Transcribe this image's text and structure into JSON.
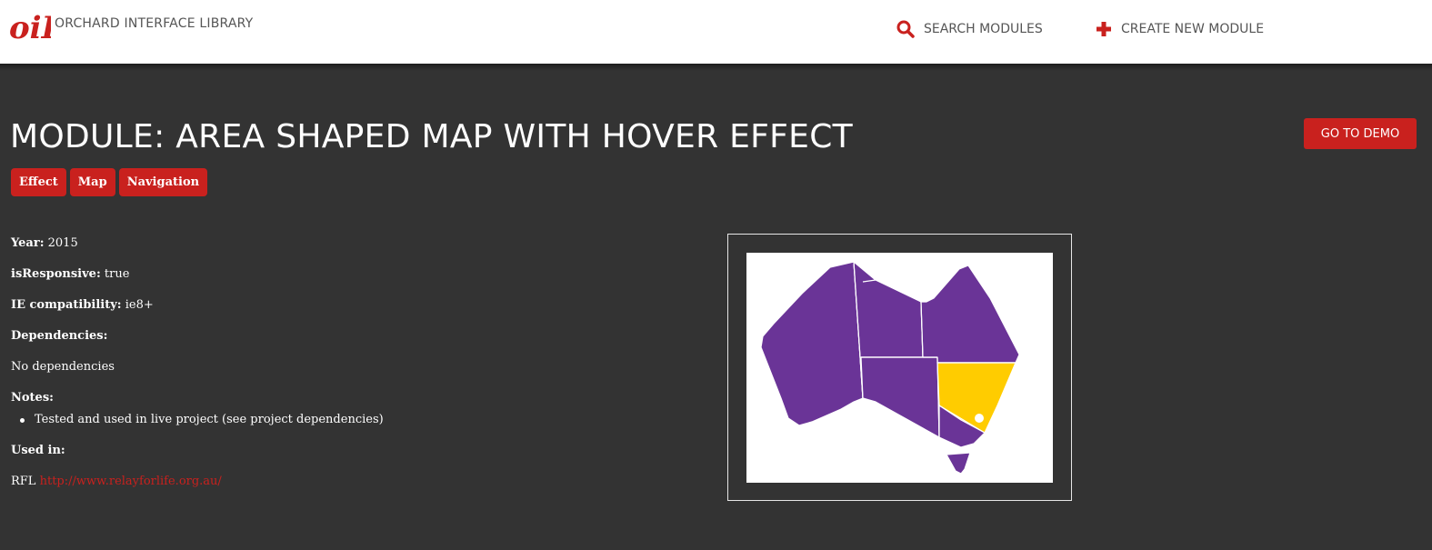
{
  "brand": {
    "logo_text": "oiL",
    "name": "ORCHARD INTERFACE LIBRARY"
  },
  "nav": {
    "search_label": "SEARCH MODULES",
    "create_label": "CREATE NEW MODULE"
  },
  "module": {
    "title": "MODULE: AREA SHAPED MAP WITH HOVER EFFECT",
    "demo_label": "GO TO DEMO",
    "tags": [
      "Effect",
      "Map",
      "Navigation"
    ]
  },
  "details": {
    "year_label": "Year:",
    "year_value": "2015",
    "responsive_label": "isResponsive:",
    "responsive_value": "true",
    "ie_label": "IE compatibility:",
    "ie_value": "ie8+",
    "dependencies_label": "Dependencies:",
    "dependencies_value": "No dependencies",
    "notes_label": "Notes:",
    "notes": [
      "Tested and used in live project (see project dependencies)"
    ],
    "used_in_label": "Used in:",
    "used_in_prefix": "RFL",
    "used_in_link": "http://www.relayforlife.org.au/"
  },
  "map": {
    "base_color": "#6a3497",
    "highlight_color": "#ffcc00",
    "highlighted_region": "New South Wales"
  },
  "colors": {
    "accent": "#c9211e",
    "background": "#333333",
    "header": "#ffffff"
  }
}
